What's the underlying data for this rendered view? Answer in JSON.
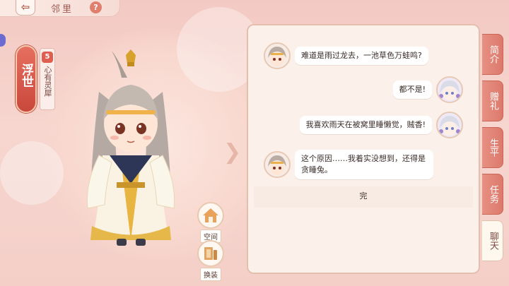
{
  "header": {
    "back_icon": "back-arrow-icon",
    "title": "邻里",
    "help_label": "?"
  },
  "left_tab": {
    "label": "浮世"
  },
  "relationship": {
    "level": "5",
    "label": "心有灵犀"
  },
  "buttons": {
    "space_label": "空间",
    "outfit_label": "换装"
  },
  "chat": {
    "messages": [
      {
        "side": "left",
        "text": "难道是雨过龙去，一池草色万蛙鸣?"
      },
      {
        "side": "right",
        "text": "都不是!"
      },
      {
        "side": "right",
        "text": "我喜欢雨天在被窝里睡懒觉，贼香!"
      },
      {
        "side": "left",
        "text": "这个原因……我着实没想到，还得是贪睡兔。"
      }
    ],
    "end_label": "完"
  },
  "right_tabs": [
    {
      "label": "简介",
      "active": false
    },
    {
      "label": "赠礼",
      "active": false
    },
    {
      "label": "生平",
      "active": false
    },
    {
      "label": "任务",
      "active": false
    },
    {
      "label": "聊天",
      "active": true
    }
  ],
  "colors": {
    "accent": "#e05e4f",
    "panel": "#fbf1ea",
    "tab": "#e08576"
  }
}
